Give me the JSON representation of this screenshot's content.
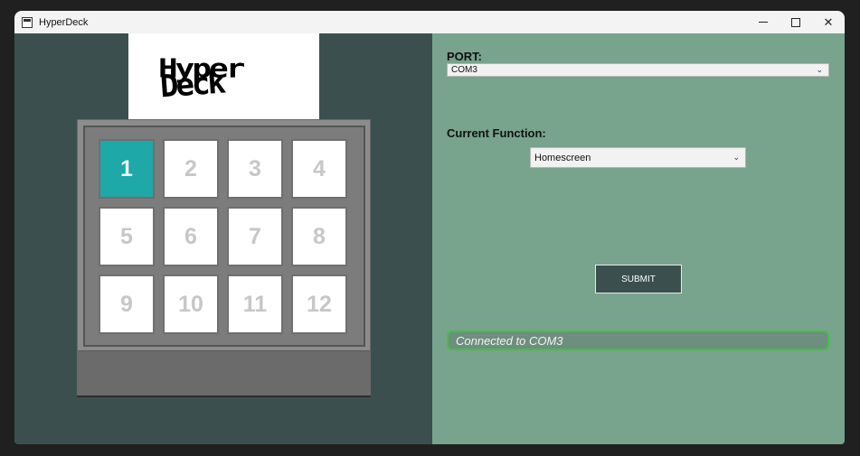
{
  "window": {
    "title": "HyperDeck"
  },
  "title_controls": {
    "minimize": "minimize",
    "maximize": "maximize",
    "close": "✕"
  },
  "logo": {
    "line1": "Hyper",
    "line2": "Deck"
  },
  "keys": [
    "1",
    "2",
    "3",
    "4",
    "5",
    "6",
    "7",
    "8",
    "9",
    "10",
    "11",
    "12"
  ],
  "selected_key": "1",
  "port": {
    "label": "PORT:",
    "value": "COM3"
  },
  "function": {
    "label": "Current Function:",
    "value": "Homescreen"
  },
  "submit_label": "SUBMIT",
  "status_text": "Connected to COM3",
  "colors": {
    "left_bg": "#3b4f4e",
    "right_bg": "#78a38d",
    "active_key": "#1fa8a8",
    "status_border": "#43c043"
  }
}
